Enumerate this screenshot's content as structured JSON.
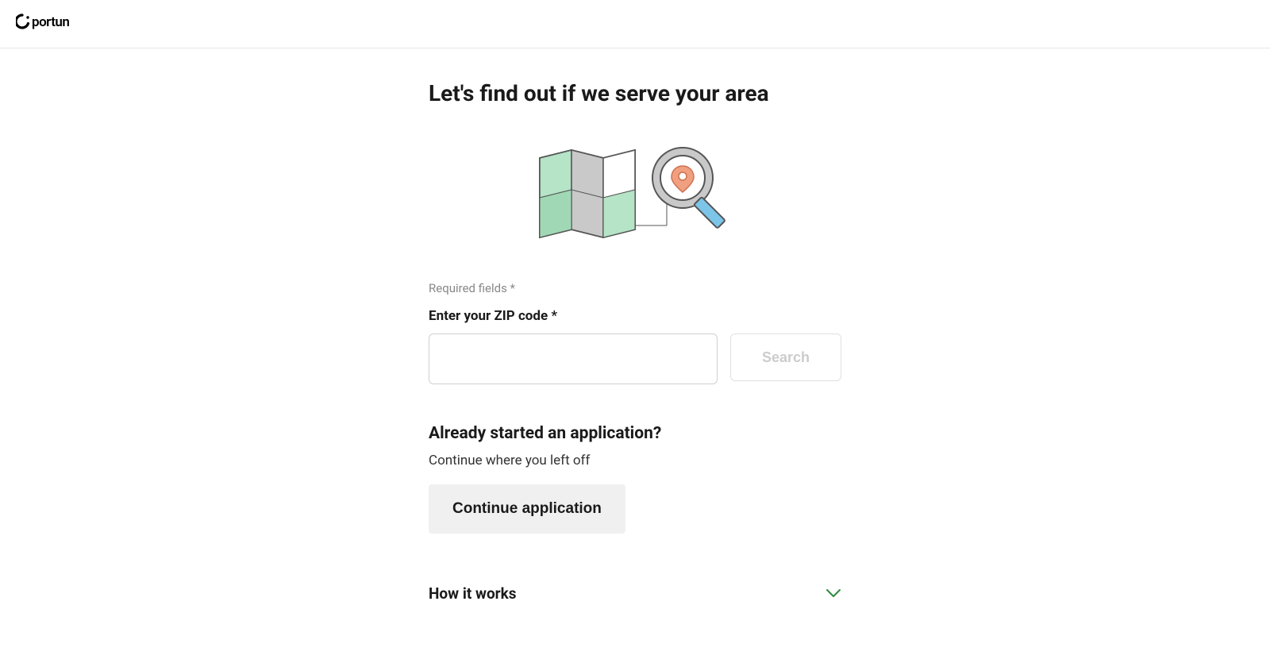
{
  "header": {
    "logo_text": "Oportun"
  },
  "main": {
    "title": "Let's find out if we serve your area",
    "required_note": "Required fields *",
    "zip_label": "Enter your ZIP code *",
    "zip_value": "",
    "search_button": "Search",
    "already_started_title": "Already started an application?",
    "already_started_subtitle": "Continue where you left off",
    "continue_button": "Continue application",
    "accordion_title": "How it works"
  }
}
